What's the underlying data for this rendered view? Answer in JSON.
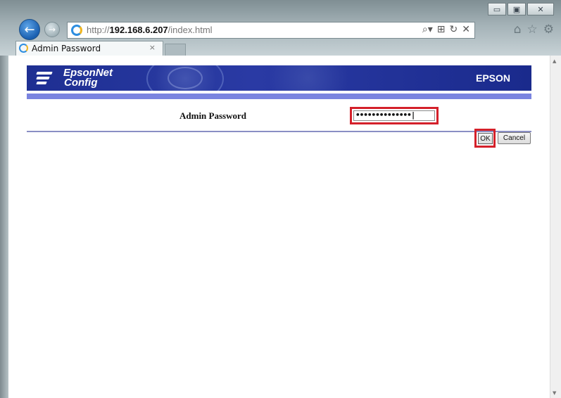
{
  "browser": {
    "url_prefix": "http://",
    "url_host": "192.168.6.207",
    "url_path": "/index.html",
    "tab_title": "Admin Password",
    "tab_close": "×",
    "back_glyph": "←",
    "forward_glyph": "→",
    "window_controls": {
      "minimize": "▭",
      "maximize": "▣",
      "close": "✕"
    },
    "address_tools": {
      "search": "⌕▾",
      "compat": "⊞",
      "refresh": "↻",
      "stop": "✕"
    },
    "right_tools": {
      "home": "⌂",
      "favorites": "☆",
      "settings": "⚙"
    },
    "icons": [
      "back-icon",
      "forward-icon",
      "ie-icon",
      "search-icon",
      "refresh-icon",
      "stop-icon",
      "home-icon",
      "star-icon",
      "gear-icon"
    ]
  },
  "page": {
    "logo_line1": "EpsonNet",
    "logo_line2": "Config",
    "brand": "EPSON",
    "field_label": "Admin Password",
    "password_value": "••••••••••••••|",
    "ok_label": "OK",
    "cancel_label": "Cancel"
  },
  "colors": {
    "banner": "#1e2f92",
    "stripe": "#7a84e0",
    "highlight": "#d4202a"
  }
}
